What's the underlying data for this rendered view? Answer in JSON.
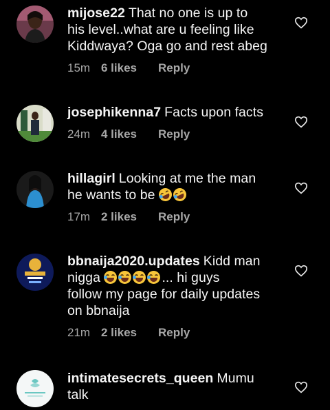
{
  "comments": [
    {
      "username": "mijose22",
      "lines": [
        "That no one is up to",
        "his level..what are u feeling like",
        "Kiddwaya? Oga go and rest abeg"
      ],
      "time": "15m",
      "likes": "6 likes",
      "reply": "Reply",
      "avatar": "profile-photo"
    },
    {
      "username": "josephikenna7",
      "lines": [
        "Facts upon facts"
      ],
      "time": "24m",
      "likes": "4 likes",
      "reply": "Reply",
      "avatar": "profile-photo"
    },
    {
      "username": "hillagirl",
      "lines": [
        "Looking at me the man",
        "he wants to be"
      ],
      "time": "17m",
      "likes": "2 likes",
      "reply": "Reply",
      "avatar": "profile-photo",
      "emojis": [
        "rolling-on-floor-laughing",
        "rolling-on-floor-laughing"
      ]
    },
    {
      "username": "bbnaija2020.updates",
      "lines": [
        "Kidd man",
        "nigga",
        "... hi guys",
        "follow my page for daily updates",
        "on bbnaija"
      ],
      "time": "21m",
      "likes": "2 likes",
      "reply": "Reply",
      "avatar": "bbnaija-logo",
      "emojis": [
        "face-with-tears-of-joy",
        "face-with-tears-of-joy",
        "face-with-tears-of-joy",
        "face-with-tears-of-joy"
      ]
    },
    {
      "username": "intimatesecrets_queen",
      "lines": [
        "Mumu",
        "talk"
      ],
      "avatar": "intimate-secrets-logo"
    }
  ],
  "icons": {
    "like": "heart-outline-icon"
  },
  "colors": {
    "background": "#000000",
    "text": "#f5f5f5",
    "meta": "#a8a8a8"
  }
}
